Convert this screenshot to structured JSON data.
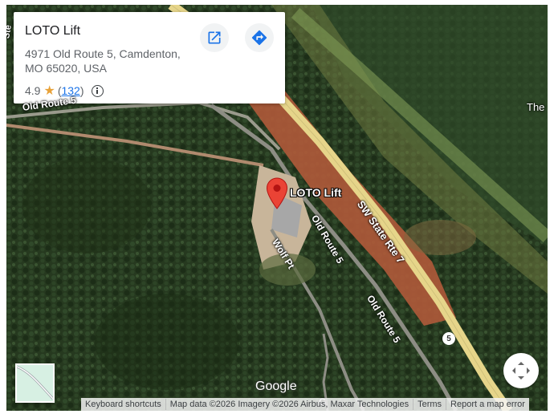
{
  "place": {
    "name": "LOTO Lift",
    "address": "4971 Old Route 5, Camdenton, MO 65020, USA",
    "rating_value": "4.9",
    "rating_count_open": "(",
    "rating_count": "132",
    "rating_count_close": ")"
  },
  "icons": {
    "open_in_maps": "open-in-new-icon",
    "directions": "directions-icon",
    "info": "info-icon",
    "star": "star-icon",
    "pin": "location-pin-icon",
    "fullscreen": "camera-control-icon"
  },
  "map_labels": {
    "old_route_top": "Old Route 5",
    "state_route": "SW State Rte 7",
    "old_route_mid": "Old Route 5",
    "old_route_low": "Old Route 5",
    "wolf_pt": "Wolf Pt",
    "pin_label": "LOTO Lift",
    "edge_right": "The",
    "edge_left": "Ste",
    "shield_number": "5",
    "bottom_partial": "G"
  },
  "branding": {
    "logo": "Google"
  },
  "attribution": {
    "keyboard": "Keyboard shortcuts",
    "map_data": "Map data ©2026 Imagery ©2026 Airbus, Maxar Technologies",
    "terms": "Terms",
    "report": "Report a map error"
  },
  "colors": {
    "pin": "#ea4335",
    "link": "#1a73e8",
    "star": "#e8a23a",
    "highway": "#e6d58a",
    "forest": "#22361c"
  }
}
